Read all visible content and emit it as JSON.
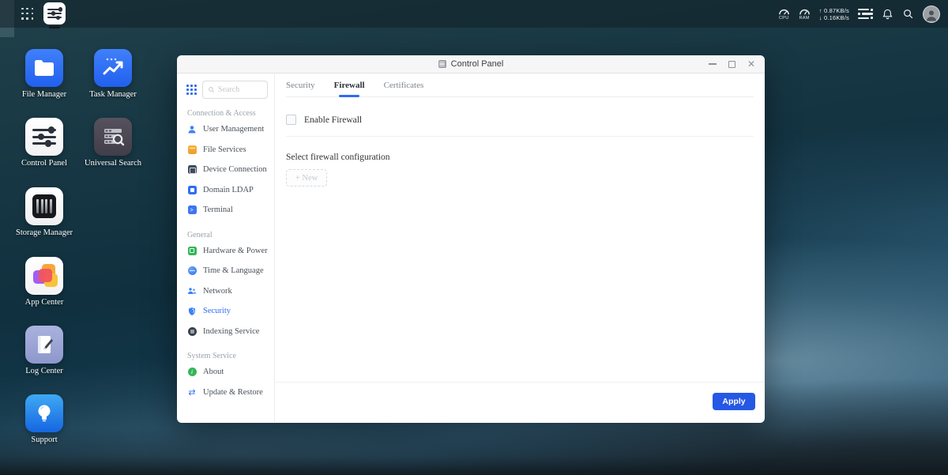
{
  "topbar": {
    "taskbar_app": "Control Panel",
    "status": {
      "cpu_label": "CPU",
      "ram_label": "RAM",
      "upload_speed": "↑ 0.87KB/s",
      "download_speed": "↓ 0.16KB/s"
    }
  },
  "desktop": {
    "icons": [
      {
        "label": "File Manager"
      },
      {
        "label": "Task Manager"
      },
      {
        "label": "Control Panel"
      },
      {
        "label": "Universal Search"
      },
      {
        "label": "Storage Manager"
      },
      {
        "label": "App Center"
      },
      {
        "label": "Log Center"
      },
      {
        "label": "Support"
      }
    ]
  },
  "window": {
    "title": "Control Panel",
    "sidebar": {
      "search_placeholder": "Search",
      "sections": [
        {
          "header": "Connection & Access",
          "items": [
            {
              "label": "User Management"
            },
            {
              "label": "File Services"
            },
            {
              "label": "Device Connection"
            },
            {
              "label": "Domain LDAP"
            },
            {
              "label": "Terminal"
            }
          ]
        },
        {
          "header": "General",
          "items": [
            {
              "label": "Hardware & Power"
            },
            {
              "label": "Time & Language"
            },
            {
              "label": "Network"
            },
            {
              "label": "Security",
              "active": true
            },
            {
              "label": "Indexing Service"
            }
          ]
        },
        {
          "header": "System Service",
          "items": [
            {
              "label": "About"
            },
            {
              "label": "Update & Restore"
            }
          ]
        }
      ]
    },
    "tabs": [
      {
        "label": "Security"
      },
      {
        "label": "Firewall",
        "active": true
      },
      {
        "label": "Certificates"
      }
    ],
    "content": {
      "enable_firewall_label": "Enable Firewall",
      "enable_firewall_checked": false,
      "select_config_label": "Select firewall configuration",
      "new_button_label": "+ New",
      "apply_button_label": "Apply"
    }
  },
  "colors": {
    "accent_blue": "#2f6bf6",
    "apply_button": "#2458e5",
    "topbar_bg": "rgba(18,30,37,0.52)"
  }
}
